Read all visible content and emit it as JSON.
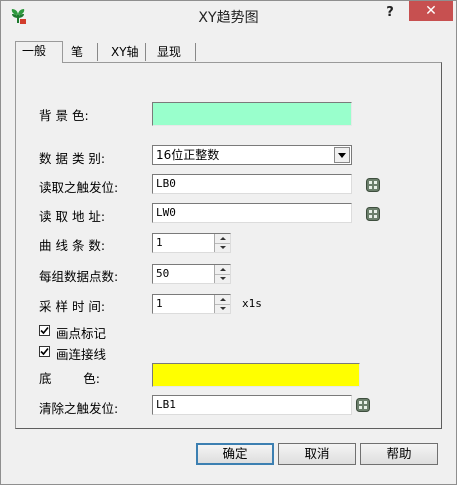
{
  "window": {
    "title": "XY趋势图",
    "help": "?",
    "close": "✕"
  },
  "tabs": [
    {
      "label": "一般",
      "active": true
    },
    {
      "label": "笔"
    },
    {
      "label": "XY轴"
    },
    {
      "label": "显现"
    }
  ],
  "form": {
    "bg_color_label": "背 景 色:",
    "bg_color": "#99ffcc",
    "data_type_label": "数 据 类 别:",
    "data_type_value": "16位正整数",
    "read_trigger_label": "读取之触发位:",
    "read_trigger_value": "LB0",
    "read_addr_label": "读 取 地 址:",
    "read_addr_value": "LW0",
    "curve_count_label": "曲 线 条 数:",
    "curve_count_value": "1",
    "points_label": "每组数据点数:",
    "points_value": "50",
    "sample_time_label": "采 样 时 间:",
    "sample_time_value": "1",
    "sample_time_unit": "x1s",
    "draw_points_label": "画点标记",
    "draw_points_checked": true,
    "draw_lines_label": "画连接线",
    "draw_lines_checked": true,
    "base_color_label": "底        色:",
    "base_color": "#ffff00",
    "clear_trigger_label": "清除之触发位:",
    "clear_trigger_value": "LB1"
  },
  "buttons": {
    "ok": "确定",
    "cancel": "取消",
    "help": "帮助"
  },
  "icons": {
    "app": "plant-icon",
    "address": "address-picker-icon"
  }
}
